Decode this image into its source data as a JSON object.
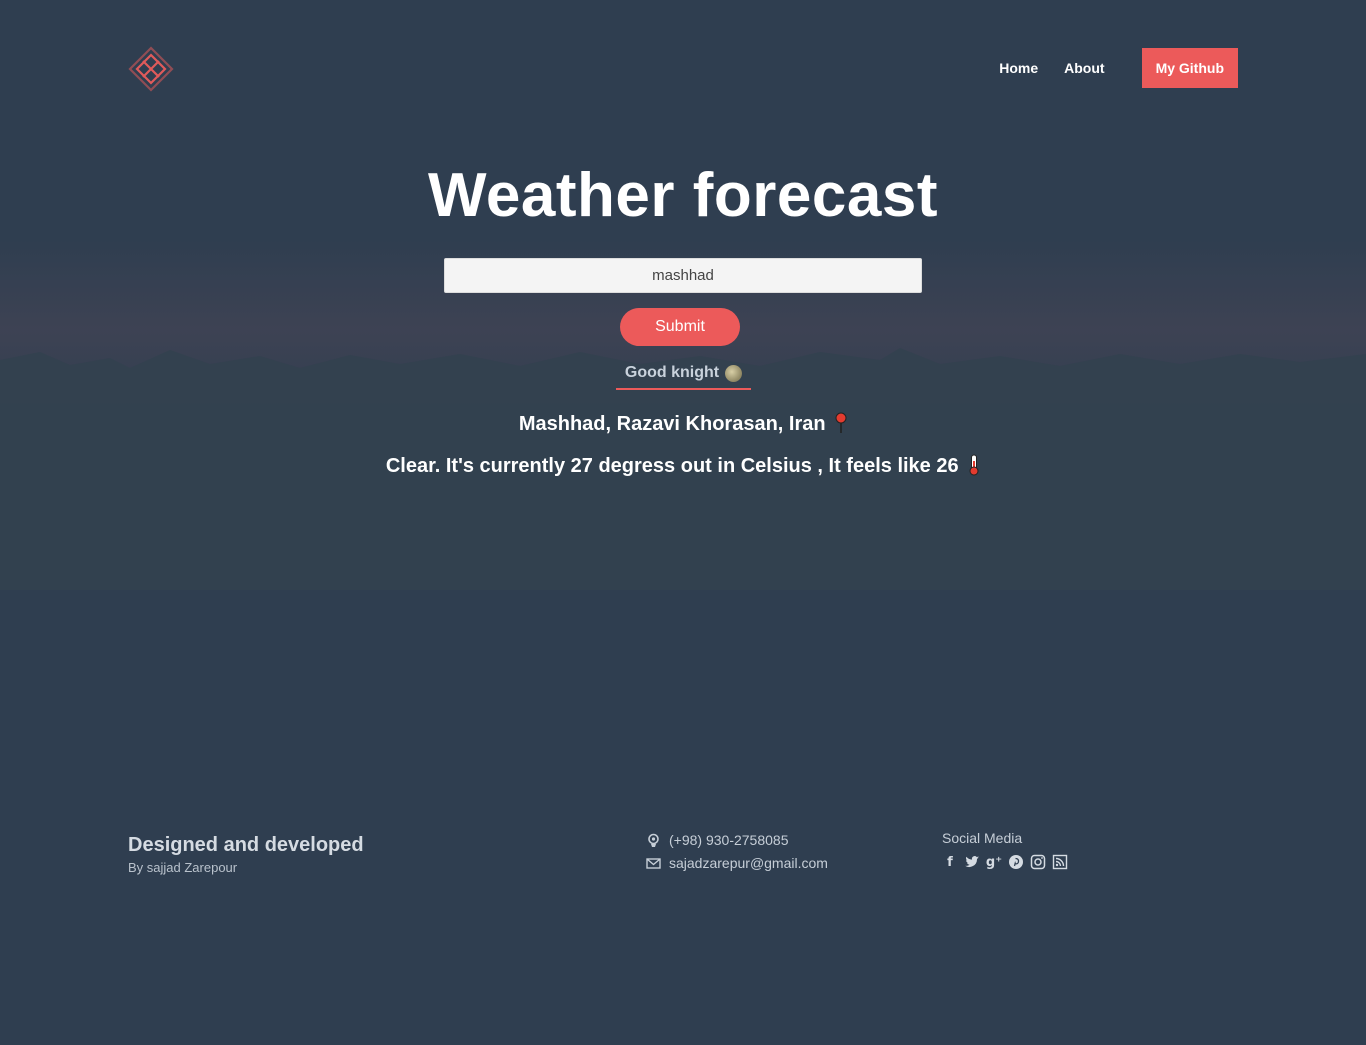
{
  "header": {
    "logo_icon": "diamond-logo-icon",
    "nav": {
      "home": "Home",
      "about": "About",
      "github": "My Github"
    }
  },
  "main": {
    "title": "Weather forecast",
    "search": {
      "value": "mashhad"
    },
    "submit_label": "Submit",
    "greeting": "Good knight",
    "greeting_icon": "moon-icon",
    "location": "Mashhad, Razavi Khorasan, Iran",
    "location_icon": "pin-icon",
    "conditions": "Clear. It's currently 27 degress out in Celsius , It feels like 26",
    "conditions_icon": "thermometer-icon"
  },
  "footer": {
    "title": "Designed and developed",
    "subtitle": "By sajjad Zarepour",
    "phone": "(+98) 930-2758085",
    "email": "sajadzarepur@gmail.com",
    "social_title": "Social Media",
    "social_icons": [
      "facebook-icon",
      "twitter-icon",
      "google-plus-icon",
      "pinterest-icon",
      "instagram-icon",
      "rss-icon"
    ]
  },
  "colors": {
    "background": "#2f3e50",
    "accent": "#ec5a5a"
  }
}
